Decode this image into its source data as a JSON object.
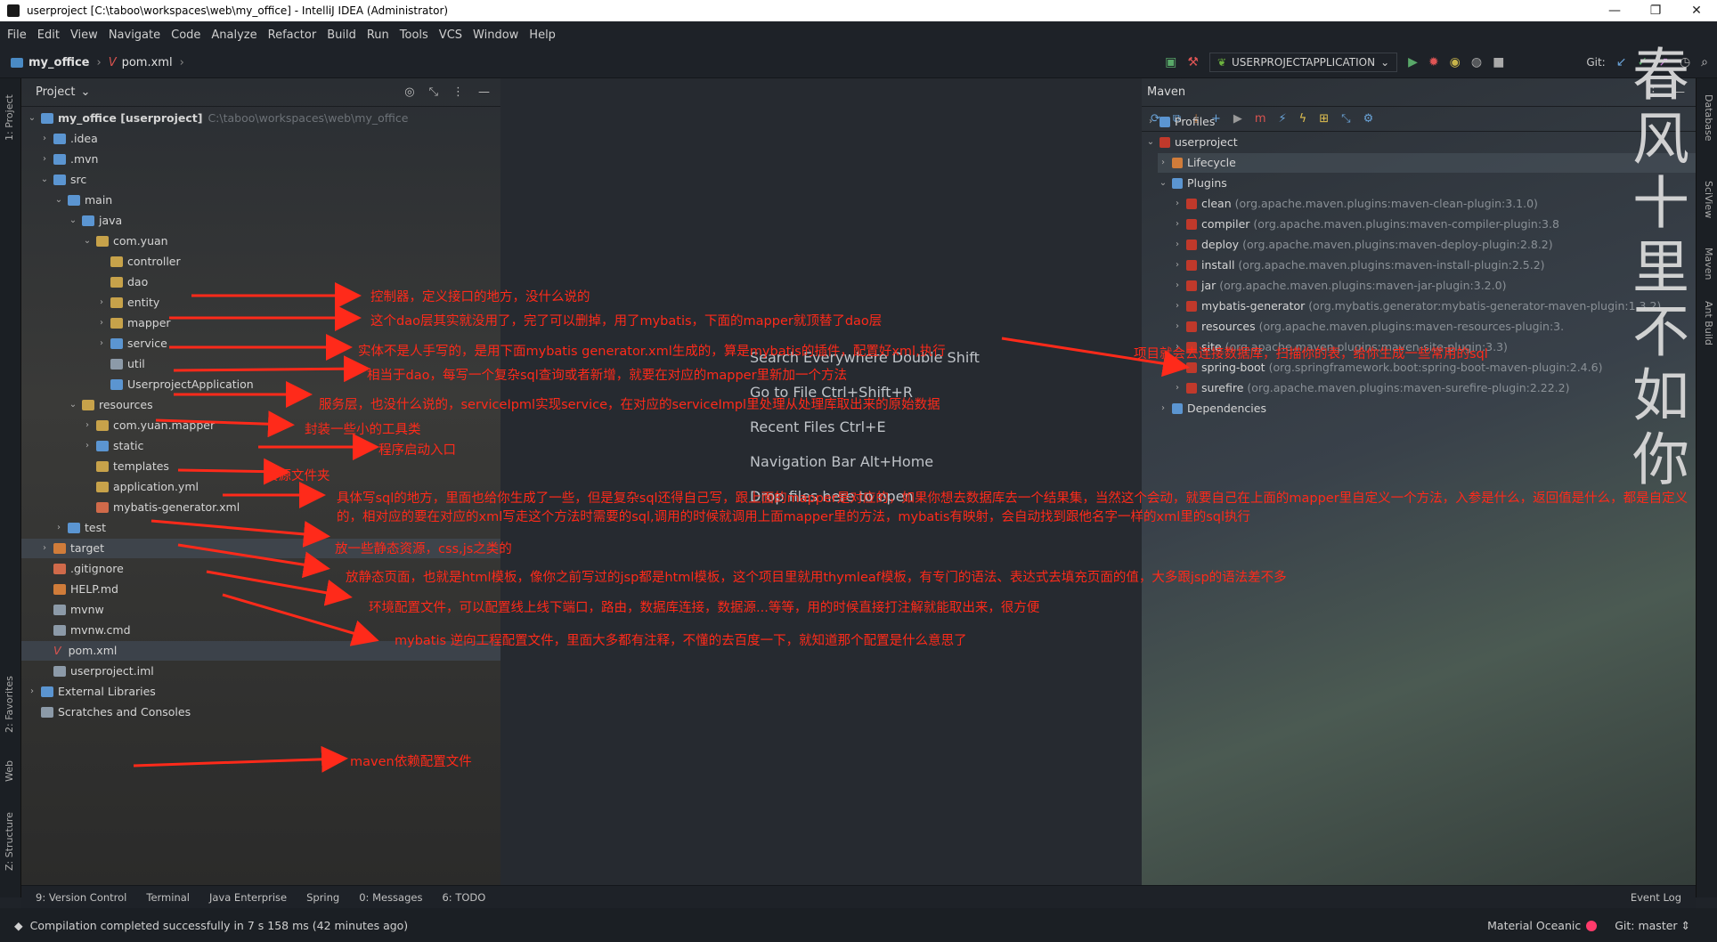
{
  "window": {
    "title": "userproject [C:\\taboo\\workspaces\\web\\my_office] - IntelliJ IDEA (Administrator)",
    "minimize": "—",
    "maximize": "❐",
    "close": "✕"
  },
  "menu": [
    "File",
    "Edit",
    "View",
    "Navigate",
    "Code",
    "Analyze",
    "Refactor",
    "Build",
    "Run",
    "Tools",
    "VCS",
    "Window",
    "Help"
  ],
  "breadcrumb": {
    "project": "my_office",
    "file": "pom.xml"
  },
  "run_config": {
    "name": "USERPROJECTAPPLICATION",
    "git_label": "Git:"
  },
  "left_stripe": {
    "project": "1: Project",
    "favorites": "2: Favorites",
    "web": "Web",
    "structure": "Z: Structure"
  },
  "right_stripe": {
    "database": "Database",
    "sciview": "SciView",
    "maven": "Maven",
    "ant": "Ant Build"
  },
  "project_panel": {
    "title": "Project",
    "tree": [
      {
        "label": "my_office [userproject]",
        "extra": "C:\\taboo\\workspaces\\web\\my_office"
      },
      {
        "label": ".idea"
      },
      {
        "label": ".mvn"
      },
      {
        "label": "src"
      },
      {
        "label": "main"
      },
      {
        "label": "java"
      },
      {
        "label": "com.yuan"
      },
      {
        "label": "controller"
      },
      {
        "label": "dao"
      },
      {
        "label": "entity"
      },
      {
        "label": "mapper"
      },
      {
        "label": "service"
      },
      {
        "label": "util"
      },
      {
        "label": "UserprojectApplication"
      },
      {
        "label": "resources"
      },
      {
        "label": "com.yuan.mapper"
      },
      {
        "label": "static"
      },
      {
        "label": "templates"
      },
      {
        "label": "application.yml"
      },
      {
        "label": "mybatis-generator.xml"
      },
      {
        "label": "test"
      },
      {
        "label": "target"
      },
      {
        "label": ".gitignore"
      },
      {
        "label": "HELP.md"
      },
      {
        "label": "mvnw"
      },
      {
        "label": "mvnw.cmd"
      },
      {
        "label": "pom.xml"
      },
      {
        "label": "userproject.iml"
      },
      {
        "label": "External Libraries"
      },
      {
        "label": "Scratches and Consoles"
      }
    ]
  },
  "editor_hints": [
    "Search Everywhere  Double Shift",
    "Go to File  Ctrl+Shift+R",
    "Recent Files  Ctrl+E",
    "Navigation Bar  Alt+Home",
    "Drop files here to open"
  ],
  "maven_panel": {
    "title": "Maven",
    "tree": [
      {
        "label": "Profiles"
      },
      {
        "label": "userproject"
      },
      {
        "label": "Lifecycle"
      },
      {
        "label": "Plugins"
      },
      {
        "label": "clean",
        "extra": "(org.apache.maven.plugins:maven-clean-plugin:3.1.0)"
      },
      {
        "label": "compiler",
        "extra": "(org.apache.maven.plugins:maven-compiler-plugin:3.8"
      },
      {
        "label": "deploy",
        "extra": "(org.apache.maven.plugins:maven-deploy-plugin:2.8.2)"
      },
      {
        "label": "install",
        "extra": "(org.apache.maven.plugins:maven-install-plugin:2.5.2)"
      },
      {
        "label": "jar",
        "extra": "(org.apache.maven.plugins:maven-jar-plugin:3.2.0)"
      },
      {
        "label": "mybatis-generator",
        "extra": "(org.mybatis.generator:mybatis-generator-maven-plugin:1.3.2)"
      },
      {
        "label": "resources",
        "extra": "(org.apache.maven.plugins:maven-resources-plugin:3."
      },
      {
        "label": "site",
        "extra": "(org.apache.maven.plugins:maven-site-plugin:3.3)"
      },
      {
        "label": "spring-boot",
        "extra": "(org.springframework.boot:spring-boot-maven-plugin:2.4.6)"
      },
      {
        "label": "surefire",
        "extra": "(org.apache.maven.plugins:maven-surefire-plugin:2.22.2)"
      },
      {
        "label": "Dependencies"
      }
    ]
  },
  "wallpaper_text": "春风十里不如你",
  "annotations": [
    "控制器，定义接口的地方，没什么说的",
    "这个dao层其实就没用了，完了可以删掉，用了mybatis，下面的mapper就顶替了dao层",
    "实体不是人手写的，是用下面mybatis generator.xml生成的，算是mybatis的插件，配置好xml,执行",
    "相当于dao，每写一个复杂sql查询或者新增，就要在对应的mapper里新加一个方法",
    "服务层，也没什么说的，serviceIpml实现service，在对应的serviceImpl里处理从处理库取出来的原始数据",
    "封装一些小的工具类",
    "程序启动入口",
    "资源文件夹",
    "具体写sql的地方，里面也给你生成了一些，但是复杂sql还得自己写，跟上面的mapper是对应的，如果你想去数据库去一个结果集，当然这个会动，就要自己在上面的mapper里自定义一个方法，入参是什么，返回值是什么，都是自定义的，相对应的要在对应的xml写走这个方法时需要的sql,调用的时候就调用上面mapper里的方法，mybatis有映射，会自动找到跟他名字一样的xml里的sql执行",
    "放一些静态资源，css,js之类的",
    "放静态页面，也就是html模板，像你之前写过的jsp都是html模板，这个项目里就用thymleaf模板，有专门的语法、表达式去填充页面的值，大多跟jsp的语法差不多",
    "环境配置文件，可以配置线上线下端口，路由，数据库连接，数据源...等等，用的时候直接打注解就能取出来，很方便",
    "mybatis 逆向工程配置文件，里面大多都有注释，不懂的去百度一下，就知道那个配置是什么意思了",
    "maven依赖配置文件",
    "项目就会去连接数据库，扫描你的表，给你生成一些常用的sql"
  ],
  "tool_windows": [
    "9: Version Control",
    "Terminal",
    "Java Enterprise",
    "Spring",
    "0: Messages",
    "6: TODO"
  ],
  "event_log": "Event Log",
  "status": {
    "message": "Compilation completed successfully in 7 s 158 ms (42 minutes ago)",
    "theme": "Material Oceanic",
    "git": "Git: master ⇕"
  },
  "colors": {
    "annotation": "#ff2a1a",
    "background": "#262a30",
    "accent": "#5b95d1"
  }
}
